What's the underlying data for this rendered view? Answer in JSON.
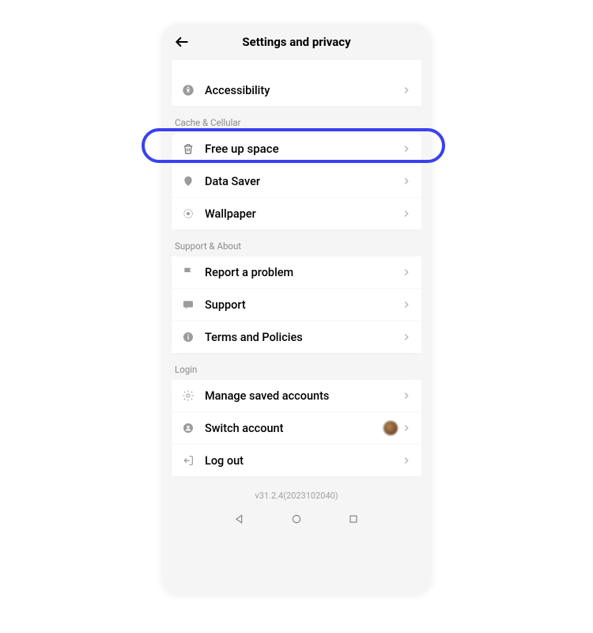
{
  "header": {
    "title": "Settings and privacy"
  },
  "sections": {
    "prior": {
      "accessibility": "Accessibility"
    },
    "cache": {
      "label": "Cache & Cellular",
      "free_up_space": "Free up space",
      "data_saver": "Data Saver",
      "wallpaper": "Wallpaper"
    },
    "support": {
      "label": "Support & About",
      "report": "Report a problem",
      "support": "Support",
      "terms": "Terms and Policies"
    },
    "login": {
      "label": "Login",
      "manage": "Manage saved accounts",
      "switch": "Switch account",
      "logout": "Log out"
    }
  },
  "version": "v31.2.4(2023102040)"
}
